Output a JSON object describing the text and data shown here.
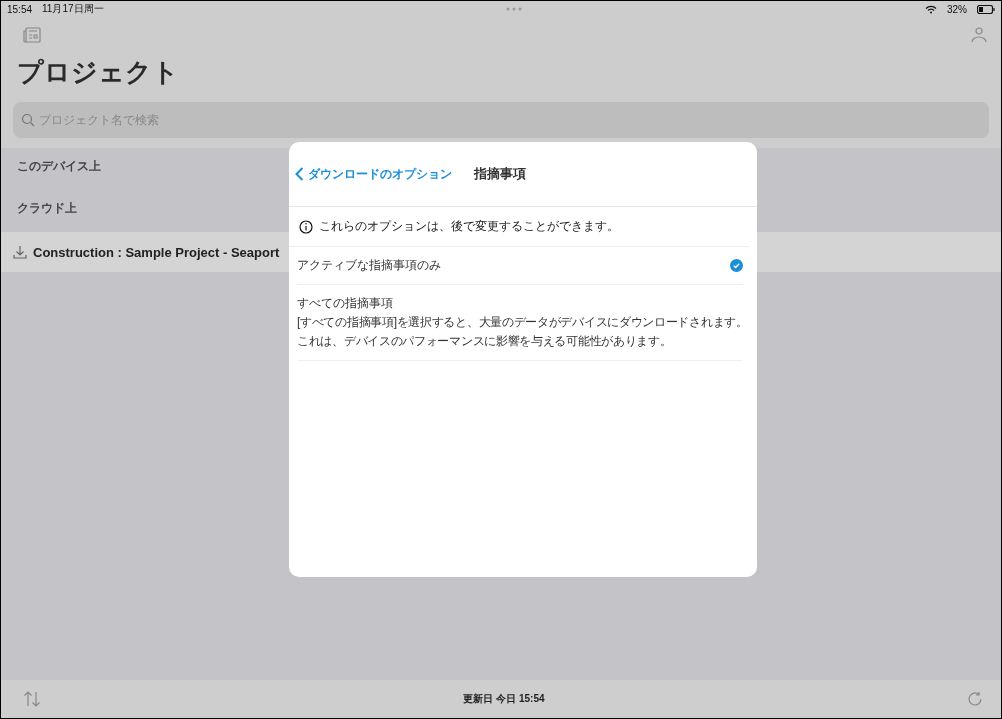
{
  "status_bar": {
    "time": "15:54",
    "date": "11月17日周一",
    "battery": "32%"
  },
  "title": "プロジェクト",
  "search": {
    "placeholder": "プロジェクト名で検索"
  },
  "sections": [
    {
      "title": "このデバイス上"
    },
    {
      "title": "クラウド上",
      "rows": [
        {
          "name": "Construction : Sample Project - Seaport"
        }
      ]
    }
  ],
  "modal": {
    "back": "ダウンロードのオプション",
    "title": "指摘事項",
    "info": "これらのオプションは、後で変更することができます。",
    "options": [
      {
        "label": "アクティブな指摘事項のみ",
        "selected": true
      },
      {
        "label": "すべての指摘事項",
        "description": [
          "[すべての指摘事項]を選択すると、大量のデータがデバイスにダウンロードされます。",
          "これは、デバイスのパフォーマンスに影響を与える可能性があります。"
        ],
        "selected": false
      }
    ]
  },
  "bottom_bar": {
    "updated": "更新日 今日 15:54"
  }
}
